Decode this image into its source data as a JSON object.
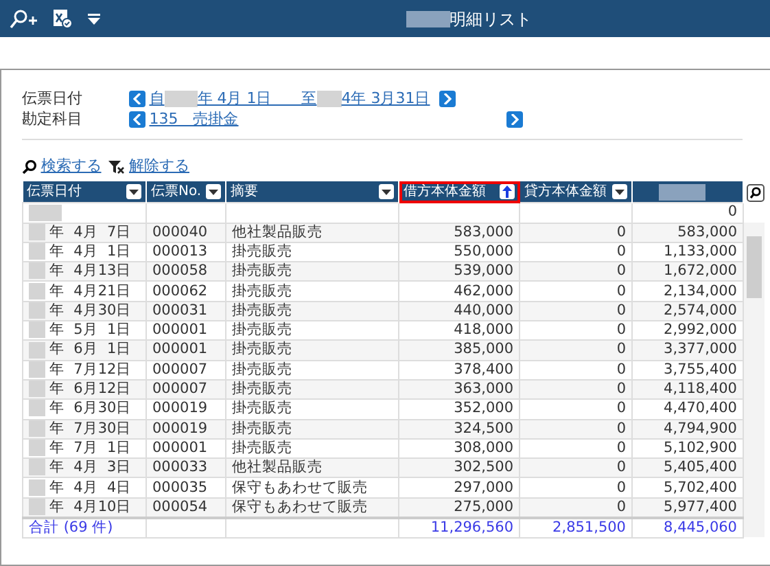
{
  "window": {
    "title": "明細リスト"
  },
  "filters": [
    {
      "label": "伝票日付",
      "parts": [
        "自",
        "年  4月 1日",
        "至",
        "4年  3月31日"
      ]
    },
    {
      "label": "勘定科目",
      "parts": [
        "135",
        "売掛金"
      ]
    }
  ],
  "actions": [
    {
      "kind": "search",
      "label": "検索する"
    },
    {
      "kind": "clear",
      "label": "解除する"
    }
  ],
  "table": {
    "columns": [
      {
        "label": "伝票日付",
        "kind": "dropdown",
        "highlighted": false
      },
      {
        "label": "伝票No.",
        "kind": "dropdown",
        "highlighted": false
      },
      {
        "label": "摘要",
        "kind": "dropdown",
        "highlighted": false
      },
      {
        "label": "借方本体金額",
        "kind": "sorted",
        "highlighted": true
      },
      {
        "label": "貸方本体金額",
        "kind": "dropdown",
        "highlighted": false
      },
      {
        "kind": "redacted",
        "highlighted": false
      }
    ],
    "opening_balance": "0",
    "rows": [
      {
        "date": "年  4月  7日",
        "no": "000040",
        "summary": "他社製品販売",
        "debit": "583,000",
        "credit": "0",
        "balance": "583,000"
      },
      {
        "date": "年  4月  1日",
        "no": "000013",
        "summary": "掛売販売",
        "debit": "550,000",
        "credit": "0",
        "balance": "1,133,000"
      },
      {
        "date": "年  4月13日",
        "no": "000058",
        "summary": "掛売販売",
        "debit": "539,000",
        "credit": "0",
        "balance": "1,672,000"
      },
      {
        "date": "年  4月21日",
        "no": "000062",
        "summary": "掛売販売",
        "debit": "462,000",
        "credit": "0",
        "balance": "2,134,000"
      },
      {
        "date": "年  4月30日",
        "no": "000031",
        "summary": "掛売販売",
        "debit": "440,000",
        "credit": "0",
        "balance": "2,574,000"
      },
      {
        "date": "年  5月  1日",
        "no": "000001",
        "summary": "掛売販売",
        "debit": "418,000",
        "credit": "0",
        "balance": "2,992,000"
      },
      {
        "date": "年  6月  1日",
        "no": "000001",
        "summary": "掛売販売",
        "debit": "385,000",
        "credit": "0",
        "balance": "3,377,000"
      },
      {
        "date": "年  7月12日",
        "no": "000007",
        "summary": "掛売販売",
        "debit": "378,400",
        "credit": "0",
        "balance": "3,755,400"
      },
      {
        "date": "年  6月12日",
        "no": "000007",
        "summary": "掛売販売",
        "debit": "363,000",
        "credit": "0",
        "balance": "4,118,400"
      },
      {
        "date": "年  6月30日",
        "no": "000019",
        "summary": "掛売販売",
        "debit": "352,000",
        "credit": "0",
        "balance": "4,470,400"
      },
      {
        "date": "年  7月30日",
        "no": "000019",
        "summary": "掛売販売",
        "debit": "324,500",
        "credit": "0",
        "balance": "4,794,900"
      },
      {
        "date": "年  7月  1日",
        "no": "000001",
        "summary": "掛売販売",
        "debit": "308,000",
        "credit": "0",
        "balance": "5,102,900"
      },
      {
        "date": "年  4月  3日",
        "no": "000033",
        "summary": "他社製品販売",
        "debit": "302,500",
        "credit": "0",
        "balance": "5,405,400"
      },
      {
        "date": "年  4月  4日",
        "no": "000035",
        "summary": "保守もあわせて販売",
        "debit": "297,000",
        "credit": "0",
        "balance": "5,702,400"
      },
      {
        "date": "年  4月10日",
        "no": "000054",
        "summary": "保守もあわせて販売",
        "debit": "275,000",
        "credit": "0",
        "balance": "5,977,400"
      }
    ],
    "total": {
      "label": "合計 (69 件)",
      "debit": "11,296,560",
      "credit": "2,851,500",
      "balance": "8,445,060"
    }
  }
}
